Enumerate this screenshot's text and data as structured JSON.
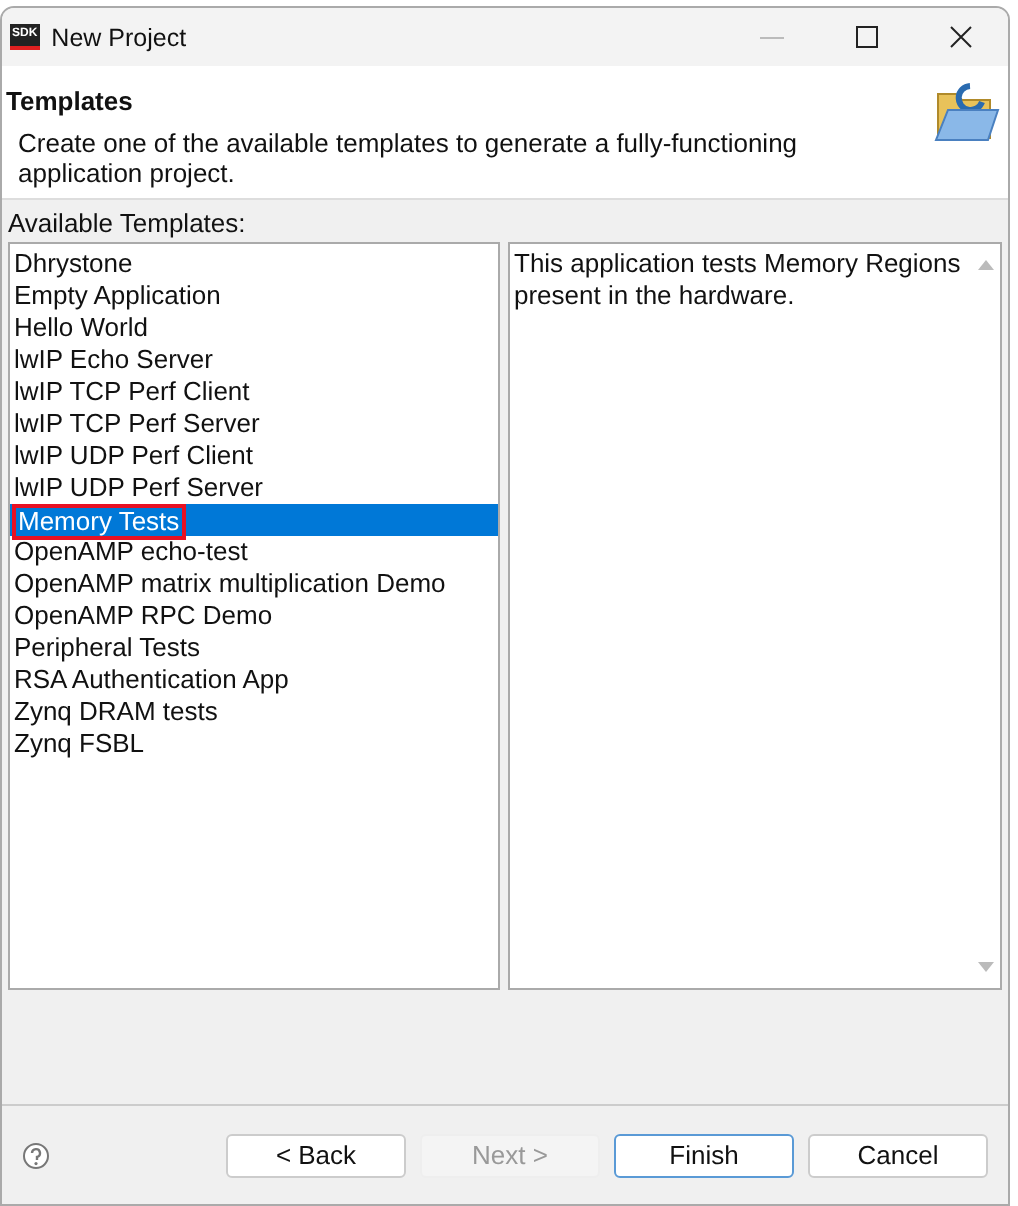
{
  "window": {
    "title": "New Project",
    "logo": "SDK"
  },
  "header": {
    "title": "Templates",
    "description": "Create one of the available templates to generate a fully-functioning application project."
  },
  "templates_label": "Available Templates:",
  "templates": [
    {
      "label": "Dhrystone",
      "selected": false,
      "outlined": false
    },
    {
      "label": "Empty Application",
      "selected": false,
      "outlined": false
    },
    {
      "label": "Hello World",
      "selected": false,
      "outlined": false
    },
    {
      "label": "lwIP Echo Server",
      "selected": false,
      "outlined": false
    },
    {
      "label": "lwIP TCP Perf Client",
      "selected": false,
      "outlined": false
    },
    {
      "label": "lwIP TCP Perf Server",
      "selected": false,
      "outlined": false
    },
    {
      "label": "lwIP UDP Perf Client",
      "selected": false,
      "outlined": false
    },
    {
      "label": "lwIP UDP Perf Server",
      "selected": false,
      "outlined": false
    },
    {
      "label": "Memory Tests",
      "selected": true,
      "outlined": true
    },
    {
      "label": "OpenAMP echo-test",
      "selected": false,
      "outlined": false
    },
    {
      "label": "OpenAMP matrix multiplication Demo",
      "selected": false,
      "outlined": false
    },
    {
      "label": "OpenAMP RPC Demo",
      "selected": false,
      "outlined": false
    },
    {
      "label": "Peripheral Tests",
      "selected": false,
      "outlined": false
    },
    {
      "label": "RSA Authentication App",
      "selected": false,
      "outlined": false
    },
    {
      "label": "Zynq DRAM tests",
      "selected": false,
      "outlined": false
    },
    {
      "label": "Zynq FSBL",
      "selected": false,
      "outlined": false
    }
  ],
  "description": "This application tests Memory Regions present in the hardware.",
  "buttons": [
    {
      "label": "< Back",
      "disabled": false,
      "default": false
    },
    {
      "label": "Next >",
      "disabled": true,
      "default": false
    },
    {
      "label": "Finish",
      "disabled": false,
      "default": true
    },
    {
      "label": "Cancel",
      "disabled": false,
      "default": false
    }
  ]
}
